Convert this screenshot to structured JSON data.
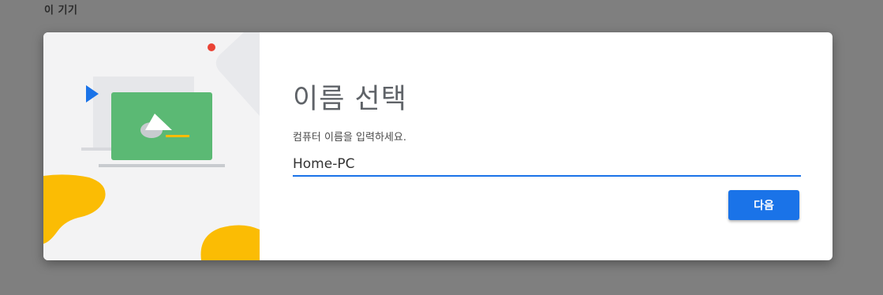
{
  "page": {
    "label": "이 기기"
  },
  "dialog": {
    "title": "이름 선택",
    "subtitle": "컴퓨터 이름을 입력하세요.",
    "name_field": {
      "value": "Home-PC"
    },
    "next_button_label": "다음"
  },
  "colors": {
    "backdrop": "#7f7f7f",
    "accent": "#1a73e8",
    "illustration_green": "#5bb974",
    "illustration_yellow": "#fbbc04",
    "illustration_red": "#ea4335"
  }
}
